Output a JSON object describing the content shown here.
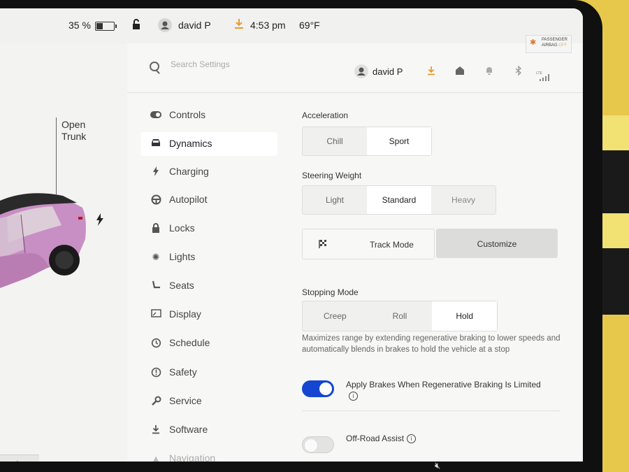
{
  "status_bar": {
    "battery_percent": "35 %",
    "user_name": "david P",
    "time": "4:53 pm",
    "temperature": "69°F",
    "airbag_line1": "PASSENGER",
    "airbag_line2": "AIRBAG",
    "airbag_line3": "OFF"
  },
  "car_panel": {
    "open_trunk": "Open Trunk"
  },
  "header": {
    "search_placeholder": "Search Settings",
    "user_name": "david P",
    "lte": "LTE"
  },
  "nav": [
    {
      "label": "Controls",
      "icon": "toggle-icon"
    },
    {
      "label": "Dynamics",
      "icon": "car-icon",
      "active": true
    },
    {
      "label": "Charging",
      "icon": "bolt-icon"
    },
    {
      "label": "Autopilot",
      "icon": "steering-wheel-icon"
    },
    {
      "label": "Locks",
      "icon": "lock-icon"
    },
    {
      "label": "Lights",
      "icon": "sun-icon"
    },
    {
      "label": "Seats",
      "icon": "seat-icon"
    },
    {
      "label": "Display",
      "icon": "display-icon"
    },
    {
      "label": "Schedule",
      "icon": "clock-icon"
    },
    {
      "label": "Safety",
      "icon": "alert-icon"
    },
    {
      "label": "Service",
      "icon": "wrench-icon"
    },
    {
      "label": "Software",
      "icon": "download-icon"
    },
    {
      "label": "Navigation",
      "icon": "navigation-icon"
    }
  ],
  "acceleration": {
    "title": "Acceleration",
    "options": [
      "Chill",
      "Sport"
    ],
    "selected": "Sport"
  },
  "steering": {
    "title": "Steering Weight",
    "options": [
      "Light",
      "Standard",
      "Heavy"
    ],
    "selected": "Standard"
  },
  "track": {
    "track_mode": "Track Mode",
    "customize": "Customize"
  },
  "stopping": {
    "title": "Stopping Mode",
    "options": [
      "Creep",
      "Roll",
      "Hold"
    ],
    "selected": "Hold",
    "description": "Maximizes range by extending regenerative braking to lower speeds and automatically blends in brakes to hold the vehicle at a stop"
  },
  "apply_brakes": {
    "label": "Apply Brakes When Regenerative Braking Is Limited",
    "on": true
  },
  "off_road": {
    "label": "Off-Road Assist",
    "on": false
  },
  "colors": {
    "accent": "#1446d2",
    "car_body": "#c88fc4"
  }
}
